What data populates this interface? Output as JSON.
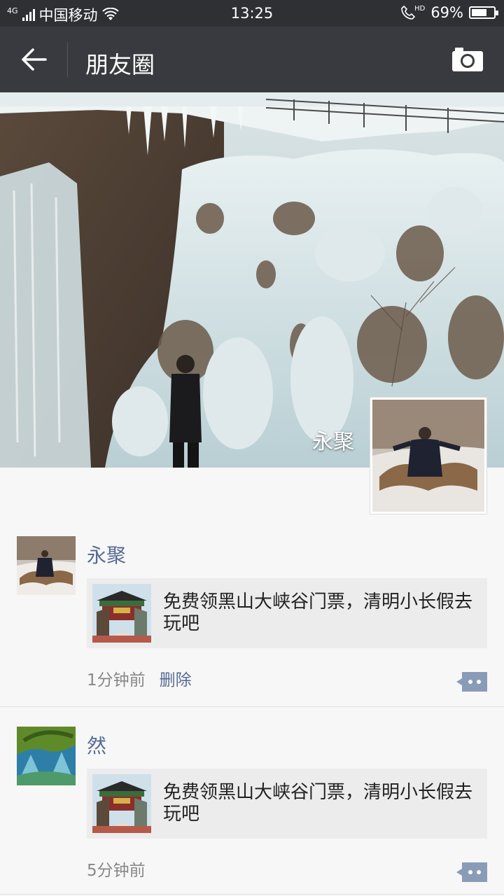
{
  "status_bar": {
    "network_type": "4G",
    "carrier": "中国移动",
    "time": "13:25",
    "hd_label": "HD",
    "battery_percent": "69%",
    "battery_level": 0.69
  },
  "header": {
    "title": "朋友圈",
    "back_icon": "arrow-left-icon",
    "camera_icon": "camera-icon"
  },
  "cover": {
    "user_name": "永聚"
  },
  "posts": [
    {
      "author": "永聚",
      "link_text": "免费领黑山大峡谷门票，清明小长假去玩吧",
      "time": "1分钟前",
      "delete_label": "删除"
    },
    {
      "author": "然",
      "link_text": "免费领黑山大峡谷门票，清明小长假去玩吧",
      "time": "5分钟前"
    }
  ],
  "colors": {
    "status_bar_bg": "#2e3034",
    "title_bar_bg": "#393a3f",
    "link_blue": "#576b95",
    "comment_icon": "#8a9bb8"
  }
}
